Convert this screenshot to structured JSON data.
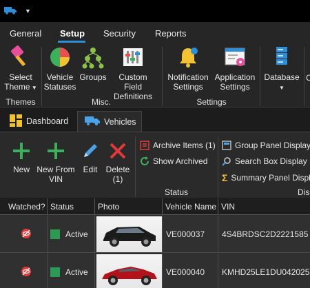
{
  "menu": {
    "tabs": [
      {
        "label": "General"
      },
      {
        "label": "Setup"
      },
      {
        "label": "Security"
      },
      {
        "label": "Reports"
      }
    ]
  },
  "ribbon": {
    "select_theme": {
      "line1": "Select",
      "line2": "Theme"
    },
    "vehicle_statuses": {
      "line1": "Vehicle",
      "line2": "Statuses"
    },
    "groups": {
      "line1": "Groups"
    },
    "custom_field": {
      "line1": "Custom Field",
      "line2": "Definitions"
    },
    "notification": {
      "line1": "Notification",
      "line2": "Settings"
    },
    "application": {
      "line1": "Application",
      "line2": "Settings"
    },
    "database": {
      "line1": "Database"
    },
    "group_labels": {
      "themes": "Themes",
      "misc": "Misc.",
      "settings": "Settings"
    },
    "overflow_char": "C"
  },
  "doc_tabs": [
    {
      "label": "Dashboard"
    },
    {
      "label": "Vehicles"
    }
  ],
  "toolbar": {
    "new": {
      "line1": "New"
    },
    "new_from_vin": {
      "line1": "New From",
      "line2": "VIN"
    },
    "edit": {
      "line1": "Edit"
    },
    "delete": {
      "line1": "Delete",
      "line2": "(1)"
    },
    "archive_items": "Archive Items (1)",
    "show_archived": "Show Archived",
    "group_panel": "Group Panel Display",
    "search_box": "Search Box Display",
    "summary_panel": "Summary Panel Displ",
    "status_label": "Status",
    "display_label": "Dis"
  },
  "grid": {
    "columns": [
      "Watched?",
      "Status",
      "Photo",
      "Vehicle Name",
      "VIN"
    ],
    "rows": [
      {
        "status": "Active",
        "vehicle_name": "VE000037",
        "vin": "4S4BRDSC2D2221585",
        "car_color": "#1b1b1b"
      },
      {
        "status": "Active",
        "vehicle_name": "VE000040",
        "vin": "KMHD25LE1DU042025",
        "car_color": "#b3121a"
      }
    ]
  },
  "colors": {
    "accent": "#2e8fd8",
    "active_status": "#2b9a53",
    "delete_red": "#e03a3a",
    "add_green": "#3cb05a"
  }
}
